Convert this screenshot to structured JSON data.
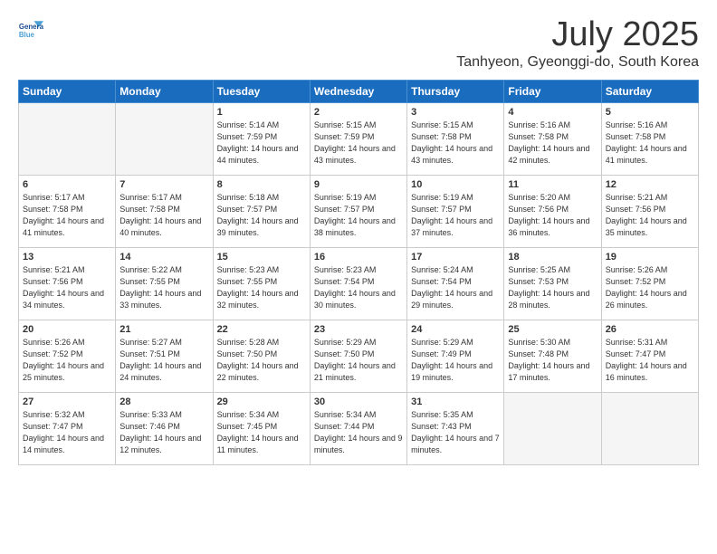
{
  "header": {
    "logo_line1": "General",
    "logo_line2": "Blue",
    "month": "July 2025",
    "location": "Tanhyeon, Gyeonggi-do, South Korea"
  },
  "weekdays": [
    "Sunday",
    "Monday",
    "Tuesday",
    "Wednesday",
    "Thursday",
    "Friday",
    "Saturday"
  ],
  "weeks": [
    [
      {
        "day": "",
        "info": ""
      },
      {
        "day": "",
        "info": ""
      },
      {
        "day": "1",
        "info": "Sunrise: 5:14 AM\nSunset: 7:59 PM\nDaylight: 14 hours and 44 minutes."
      },
      {
        "day": "2",
        "info": "Sunrise: 5:15 AM\nSunset: 7:59 PM\nDaylight: 14 hours and 43 minutes."
      },
      {
        "day": "3",
        "info": "Sunrise: 5:15 AM\nSunset: 7:58 PM\nDaylight: 14 hours and 43 minutes."
      },
      {
        "day": "4",
        "info": "Sunrise: 5:16 AM\nSunset: 7:58 PM\nDaylight: 14 hours and 42 minutes."
      },
      {
        "day": "5",
        "info": "Sunrise: 5:16 AM\nSunset: 7:58 PM\nDaylight: 14 hours and 41 minutes."
      }
    ],
    [
      {
        "day": "6",
        "info": "Sunrise: 5:17 AM\nSunset: 7:58 PM\nDaylight: 14 hours and 41 minutes."
      },
      {
        "day": "7",
        "info": "Sunrise: 5:17 AM\nSunset: 7:58 PM\nDaylight: 14 hours and 40 minutes."
      },
      {
        "day": "8",
        "info": "Sunrise: 5:18 AM\nSunset: 7:57 PM\nDaylight: 14 hours and 39 minutes."
      },
      {
        "day": "9",
        "info": "Sunrise: 5:19 AM\nSunset: 7:57 PM\nDaylight: 14 hours and 38 minutes."
      },
      {
        "day": "10",
        "info": "Sunrise: 5:19 AM\nSunset: 7:57 PM\nDaylight: 14 hours and 37 minutes."
      },
      {
        "day": "11",
        "info": "Sunrise: 5:20 AM\nSunset: 7:56 PM\nDaylight: 14 hours and 36 minutes."
      },
      {
        "day": "12",
        "info": "Sunrise: 5:21 AM\nSunset: 7:56 PM\nDaylight: 14 hours and 35 minutes."
      }
    ],
    [
      {
        "day": "13",
        "info": "Sunrise: 5:21 AM\nSunset: 7:56 PM\nDaylight: 14 hours and 34 minutes."
      },
      {
        "day": "14",
        "info": "Sunrise: 5:22 AM\nSunset: 7:55 PM\nDaylight: 14 hours and 33 minutes."
      },
      {
        "day": "15",
        "info": "Sunrise: 5:23 AM\nSunset: 7:55 PM\nDaylight: 14 hours and 32 minutes."
      },
      {
        "day": "16",
        "info": "Sunrise: 5:23 AM\nSunset: 7:54 PM\nDaylight: 14 hours and 30 minutes."
      },
      {
        "day": "17",
        "info": "Sunrise: 5:24 AM\nSunset: 7:54 PM\nDaylight: 14 hours and 29 minutes."
      },
      {
        "day": "18",
        "info": "Sunrise: 5:25 AM\nSunset: 7:53 PM\nDaylight: 14 hours and 28 minutes."
      },
      {
        "day": "19",
        "info": "Sunrise: 5:26 AM\nSunset: 7:52 PM\nDaylight: 14 hours and 26 minutes."
      }
    ],
    [
      {
        "day": "20",
        "info": "Sunrise: 5:26 AM\nSunset: 7:52 PM\nDaylight: 14 hours and 25 minutes."
      },
      {
        "day": "21",
        "info": "Sunrise: 5:27 AM\nSunset: 7:51 PM\nDaylight: 14 hours and 24 minutes."
      },
      {
        "day": "22",
        "info": "Sunrise: 5:28 AM\nSunset: 7:50 PM\nDaylight: 14 hours and 22 minutes."
      },
      {
        "day": "23",
        "info": "Sunrise: 5:29 AM\nSunset: 7:50 PM\nDaylight: 14 hours and 21 minutes."
      },
      {
        "day": "24",
        "info": "Sunrise: 5:29 AM\nSunset: 7:49 PM\nDaylight: 14 hours and 19 minutes."
      },
      {
        "day": "25",
        "info": "Sunrise: 5:30 AM\nSunset: 7:48 PM\nDaylight: 14 hours and 17 minutes."
      },
      {
        "day": "26",
        "info": "Sunrise: 5:31 AM\nSunset: 7:47 PM\nDaylight: 14 hours and 16 minutes."
      }
    ],
    [
      {
        "day": "27",
        "info": "Sunrise: 5:32 AM\nSunset: 7:47 PM\nDaylight: 14 hours and 14 minutes."
      },
      {
        "day": "28",
        "info": "Sunrise: 5:33 AM\nSunset: 7:46 PM\nDaylight: 14 hours and 12 minutes."
      },
      {
        "day": "29",
        "info": "Sunrise: 5:34 AM\nSunset: 7:45 PM\nDaylight: 14 hours and 11 minutes."
      },
      {
        "day": "30",
        "info": "Sunrise: 5:34 AM\nSunset: 7:44 PM\nDaylight: 14 hours and 9 minutes."
      },
      {
        "day": "31",
        "info": "Sunrise: 5:35 AM\nSunset: 7:43 PM\nDaylight: 14 hours and 7 minutes."
      },
      {
        "day": "",
        "info": ""
      },
      {
        "day": "",
        "info": ""
      }
    ]
  ]
}
